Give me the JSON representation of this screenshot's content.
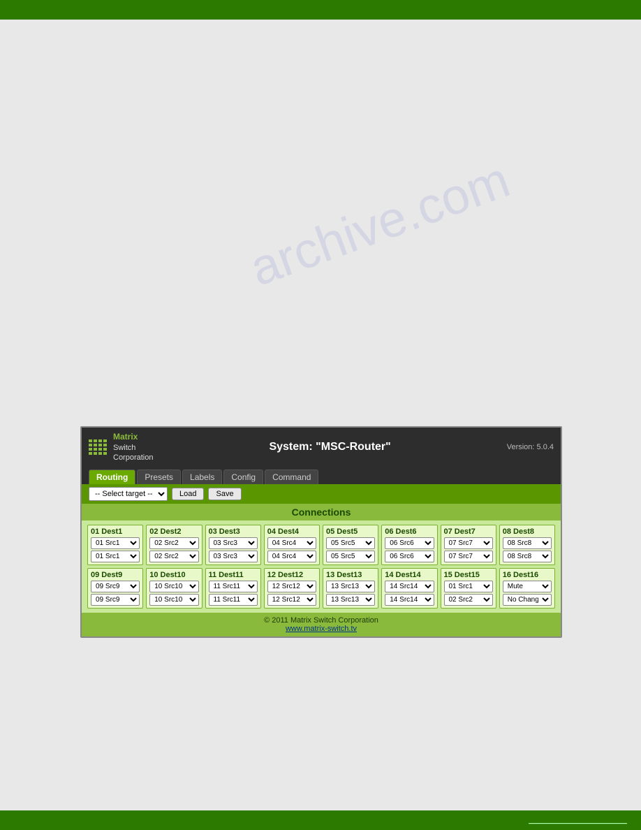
{
  "topBar": {},
  "bottomBar": {
    "text": "_______________________"
  },
  "watermark": {
    "text": "archive.com"
  },
  "panel": {
    "header": {
      "logoLines": [
        "Matrix",
        "Switch",
        "Corporation"
      ],
      "title": "System: \"MSC-Router\"",
      "version": "Version: 5.0.4"
    },
    "nav": {
      "tabs": [
        {
          "label": "Routing",
          "active": true
        },
        {
          "label": "Presets",
          "active": false
        },
        {
          "label": "Labels",
          "active": false
        },
        {
          "label": "Config",
          "active": false
        },
        {
          "label": "Command",
          "active": false
        }
      ]
    },
    "toolbar": {
      "selectPlaceholder": "-- Select target --",
      "loadLabel": "Load",
      "saveLabel": "Save"
    },
    "connectionsHeading": "Connections",
    "destinations": [
      {
        "id": 1,
        "label": "01 Dest1",
        "select1": "01 Src1",
        "select2": "01 Src1"
      },
      {
        "id": 2,
        "label": "02 Dest2",
        "select1": "02 Src2",
        "select2": "02 Src2"
      },
      {
        "id": 3,
        "label": "03 Dest3",
        "select1": "03 Src3",
        "select2": "03 Src3"
      },
      {
        "id": 4,
        "label": "04 Dest4",
        "select1": "04 Src4",
        "select2": "04 Src4"
      },
      {
        "id": 5,
        "label": "05 Dest5",
        "select1": "05 Src5",
        "select2": "05 Src5"
      },
      {
        "id": 6,
        "label": "06 Dest6",
        "select1": "06 Src6",
        "select2": "06 Src6"
      },
      {
        "id": 7,
        "label": "07 Dest7",
        "select1": "07 Src7",
        "select2": "07 Src7"
      },
      {
        "id": 8,
        "label": "08 Dest8",
        "select1": "08 Src8",
        "select2": "08 Src8"
      },
      {
        "id": 9,
        "label": "09 Dest9",
        "select1": "09 Src9",
        "select2": "09 Src9"
      },
      {
        "id": 10,
        "label": "10 Dest10",
        "select1": "10 Src10",
        "select2": "10 Src10"
      },
      {
        "id": 11,
        "label": "11 Dest11",
        "select1": "11 Src11",
        "select2": "11 Src11"
      },
      {
        "id": 12,
        "label": "12 Dest12",
        "select1": "12 Src12",
        "select2": "12 Src12"
      },
      {
        "id": 13,
        "label": "13 Dest13",
        "select1": "13 Src13",
        "select2": "13 Src13"
      },
      {
        "id": 14,
        "label": "14 Dest14",
        "select1": "14 Src14",
        "select2": "14 Src14"
      },
      {
        "id": 15,
        "label": "15 Dest15",
        "select1": "01 Src1",
        "select2": "02 Src2"
      },
      {
        "id": 16,
        "label": "16 Dest16",
        "select1": "Mute",
        "select2": "No Change"
      }
    ],
    "footer": {
      "copyright": "© 2011 Matrix Switch Corporation",
      "link": "www.matrix-switch.tv"
    }
  }
}
